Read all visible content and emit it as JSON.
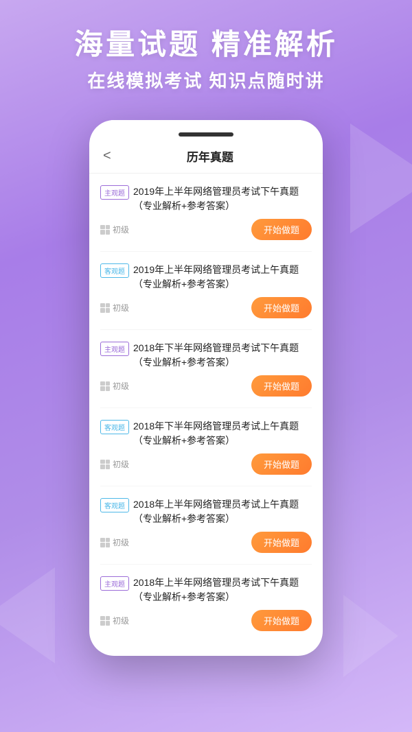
{
  "background": {
    "gradient_start": "#c8a8f0",
    "gradient_end": "#a87de8"
  },
  "header": {
    "title": "海量试题 精准解析",
    "subtitle": "在线模拟考试 知识点随时讲"
  },
  "phone": {
    "nav_back": "<",
    "page_title": "历年真题",
    "exams": [
      {
        "tag": "主观题",
        "tag_type": "subjective",
        "name": "2019年上半年网络管理员考试下午真题（专业解析+参考答案）",
        "level": "初级",
        "btn_label": "开始做题"
      },
      {
        "tag": "客观题",
        "tag_type": "objective",
        "name": "2019年上半年网络管理员考试上午真题（专业解析+参考答案）",
        "level": "初级",
        "btn_label": "开始做题"
      },
      {
        "tag": "主观题",
        "tag_type": "subjective",
        "name": "2018年下半年网络管理员考试下午真题（专业解析+参考答案）",
        "level": "初级",
        "btn_label": "开始做题"
      },
      {
        "tag": "客观题",
        "tag_type": "objective",
        "name": "2018年下半年网络管理员考试上午真题（专业解析+参考答案）",
        "level": "初级",
        "btn_label": "开始做题"
      },
      {
        "tag": "客观题",
        "tag_type": "objective",
        "name": "2018年上半年网络管理员考试上午真题（专业解析+参考答案）",
        "level": "初级",
        "btn_label": "开始做题"
      },
      {
        "tag": "主观题",
        "tag_type": "subjective",
        "name": "2018年上半年网络管理员考试下午真题（专业解析+参考答案）",
        "level": "初级",
        "btn_label": "开始做题"
      }
    ]
  }
}
